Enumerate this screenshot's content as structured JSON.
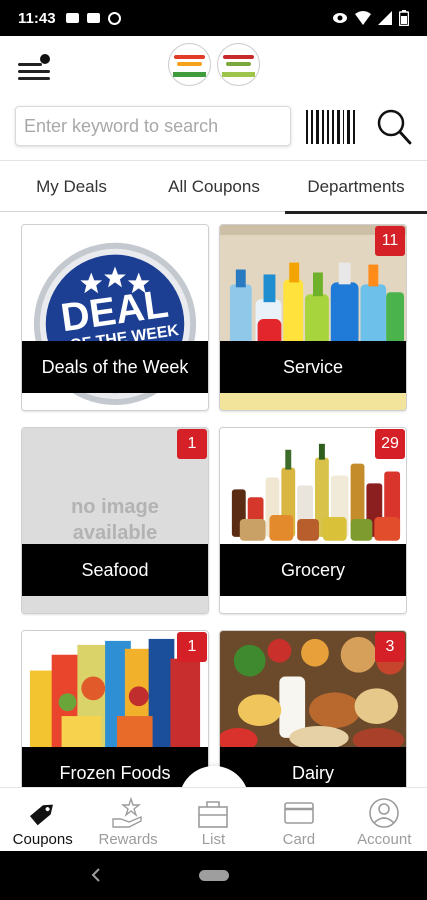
{
  "status_bar": {
    "time": "11:43",
    "left_icons": [
      "sim-card-icon",
      "gallery-icon",
      "do-not-disturb-icon"
    ],
    "right_icons": [
      "eye-icon",
      "wifi-icon",
      "signal-icon",
      "battery-icon"
    ]
  },
  "header": {
    "menu_icon": "hamburger-menu-icon",
    "logos": [
      "store-logo-1",
      "store-logo-2"
    ]
  },
  "search": {
    "placeholder": "Enter keyword to search",
    "value": "",
    "barcode_icon": "barcode-icon",
    "search_icon": "search-icon"
  },
  "tabs": [
    {
      "label": "My Deals",
      "active": false
    },
    {
      "label": "All Coupons",
      "active": false
    },
    {
      "label": "Departments",
      "active": true
    }
  ],
  "departments": [
    {
      "label": "Deals of the Week",
      "badge": null,
      "image": "deal-of-the-week-badge"
    },
    {
      "label": "Service",
      "badge": "11",
      "image": "cleaning-products"
    },
    {
      "label": "Seafood",
      "badge": "1",
      "image": "no-image",
      "no_image_text": [
        "no image",
        "available"
      ]
    },
    {
      "label": "Grocery",
      "badge": "29",
      "image": "grocery-jars-bottles"
    },
    {
      "label": "Frozen Foods",
      "badge": "1",
      "image": "frozen-food-boxes"
    },
    {
      "label": "Dairy",
      "badge": "3",
      "image": "dairy-foods"
    }
  ],
  "deal_art": {
    "line1": "DEAL",
    "line2": "OF THE WEEK"
  },
  "bottom_nav": [
    {
      "label": "Coupons",
      "icon": "tag-icon",
      "active": true
    },
    {
      "label": "Rewards",
      "icon": "rewards-star-hand-icon",
      "active": false
    },
    {
      "label": "List",
      "icon": "shopping-bag-icon",
      "active": false
    },
    {
      "label": "Card",
      "icon": "card-icon",
      "active": false
    },
    {
      "label": "Account",
      "icon": "account-icon",
      "active": false
    }
  ],
  "colors": {
    "badge": "#d42026",
    "label_bar": "#000000",
    "deal_blue": "#1c3f94",
    "inactive_nav": "#9c9c9c"
  }
}
